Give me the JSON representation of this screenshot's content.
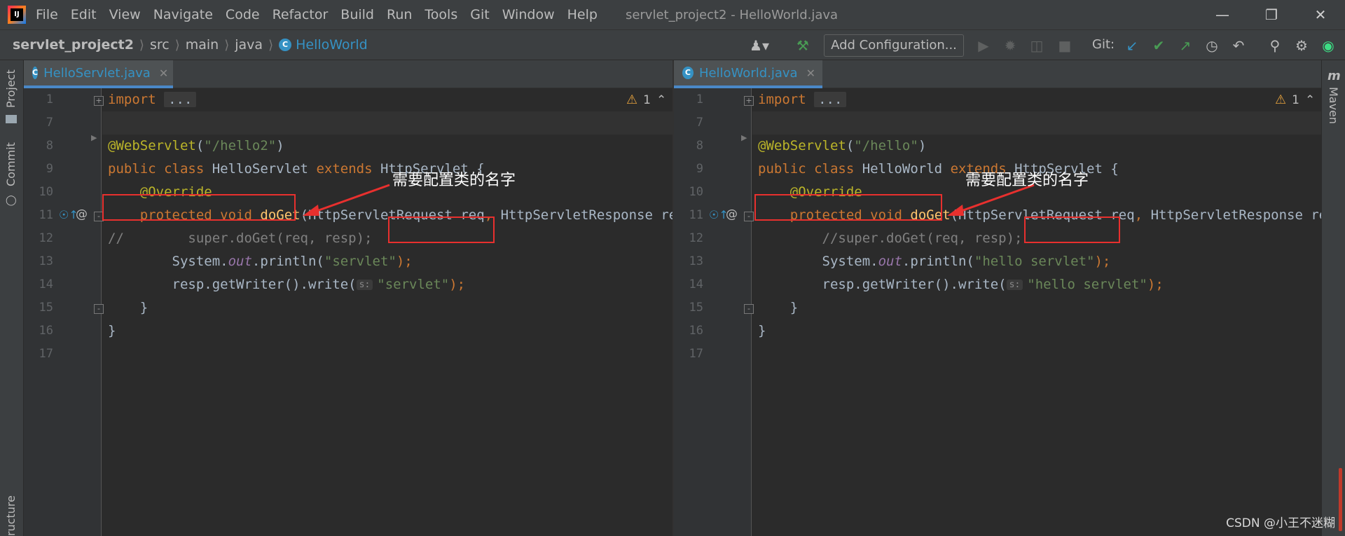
{
  "titlebar": {
    "menu": [
      "File",
      "Edit",
      "View",
      "Navigate",
      "Code",
      "Refactor",
      "Build",
      "Run",
      "Tools",
      "Git",
      "Window",
      "Help"
    ],
    "title": "servlet_project2 - HelloWorld.java"
  },
  "navbar": {
    "breadcrumbs": [
      "servlet_project2",
      "src",
      "main",
      "java",
      "HelloWorld"
    ],
    "add_configuration": "Add Configuration...",
    "git_label": "Git:"
  },
  "side": {
    "project": "Project",
    "commit": "Commit",
    "structure": "ructure",
    "maven": "Maven"
  },
  "left_editor": {
    "tab": "HelloServlet.java",
    "warnings": "1",
    "line_numbers": [
      "1",
      "7",
      "8",
      "9",
      "10",
      "11",
      "12",
      "13",
      "14",
      "15",
      "16",
      "17"
    ],
    "tokens": {
      "l1_import": "import",
      "l1_folded": "...",
      "l8_ann": "@WebServlet",
      "l8_open": "(",
      "l8_str": "\"/hello2\"",
      "l8_close": ")",
      "l9_public": "public class",
      "l9_name": " HelloServlet ",
      "l9_extends": "extends",
      "l9_super": "HttpServlet",
      "l9_brace": " {",
      "l10_ann": "@Override",
      "l11_mods": "protected void",
      "l11_fn": "doGet",
      "l11_params": "(HttpServletRequest req",
      "l11_comma": ",",
      "l11_params2": " HttpServletResponse resp)",
      "l12_comment": "//        super.doGet(req, resp);",
      "l13_sys": "System.",
      "l13_out": "out",
      "l13_println": ".println(",
      "l13_str": "\"servlet\"",
      "l13_end": ");",
      "l14_call": "resp.getWriter().write(",
      "l14_hint": "s:",
      "l14_str": "\"servlet\"",
      "l14_end": ");",
      "l15": "}",
      "l16": "}"
    },
    "callout": "需要配置类的名字"
  },
  "right_editor": {
    "tab": "HelloWorld.java",
    "warnings": "1",
    "line_numbers": [
      "1",
      "7",
      "8",
      "9",
      "10",
      "11",
      "12",
      "13",
      "14",
      "15",
      "16",
      "17"
    ],
    "tokens": {
      "l1_import": "import",
      "l1_folded": "...",
      "l8_ann": "@WebServlet",
      "l8_open": "(",
      "l8_str": "\"/hello\"",
      "l8_close": ")",
      "l9_public": "public class",
      "l9_name": " HelloWorld ",
      "l9_extends": "extends",
      "l9_super": "HttpServlet",
      "l9_brace": " {",
      "l10_ann": "@Override",
      "l11_mods": "protected void",
      "l11_fn": "doGet",
      "l11_params": "(HttpServletRequest req",
      "l11_comma": ",",
      "l11_params2": " HttpServletResponse resp)",
      "l12_comment": "//super.doGet(req, resp);",
      "l13_sys": "System.",
      "l13_out": "out",
      "l13_println": ".println(",
      "l13_str": "\"hello servlet\"",
      "l13_end": ");",
      "l14_call": "resp.getWriter().write(",
      "l14_hint": "s:",
      "l14_str": "\"hello servlet\"",
      "l14_end": ");",
      "l15": "}",
      "l16": "}"
    },
    "callout": "需要配置类的名字"
  },
  "watermark": "CSDN @小王不迷糊",
  "colors": {
    "accent": "#3592c4",
    "annotation_box": "#e8302e",
    "keyword": "#cc7832",
    "string": "#6a8759"
  }
}
